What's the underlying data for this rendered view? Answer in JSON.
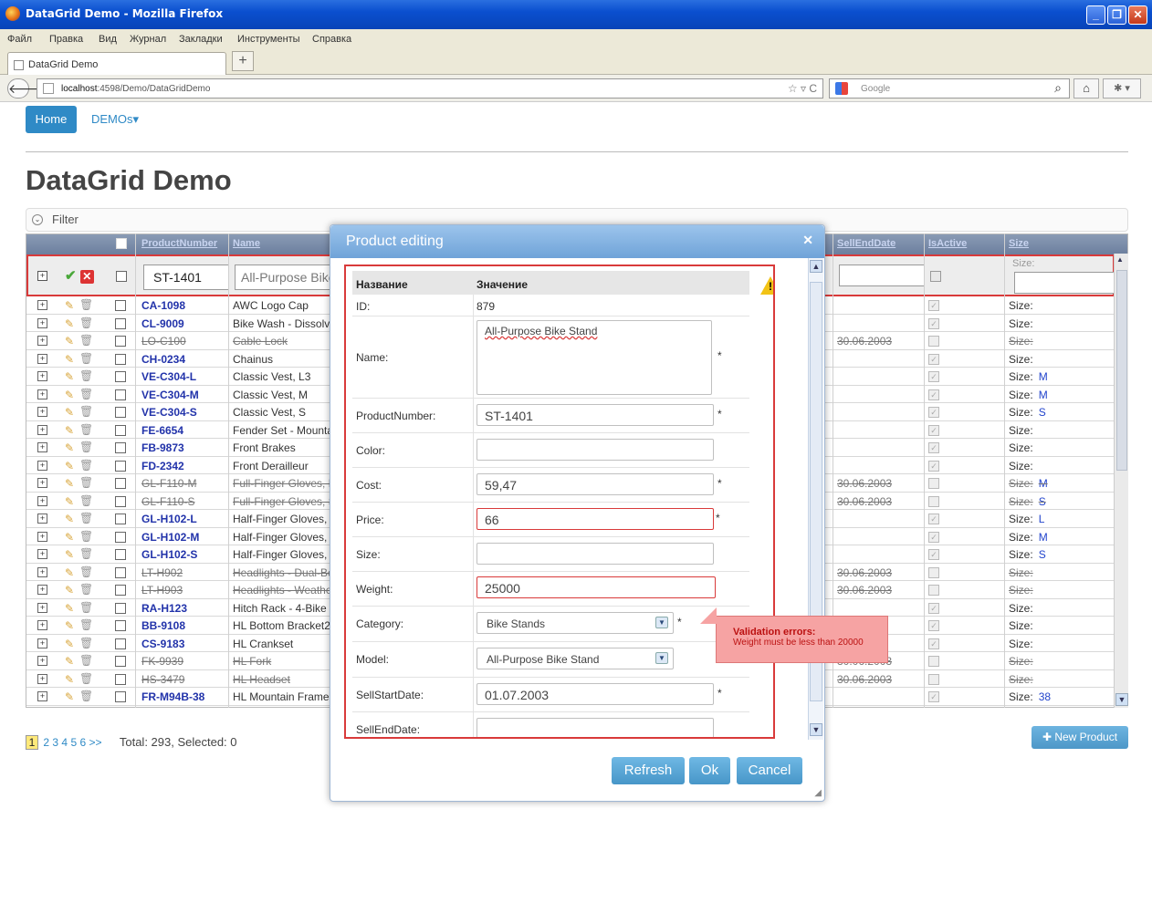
{
  "window": {
    "title": "DataGrid Demo - Mozilla Firefox"
  },
  "menu": [
    "Файл",
    "Правка",
    "Вид",
    "Журнал",
    "Закладки",
    "Инструменты",
    "Справка"
  ],
  "tab": {
    "title": "DataGrid Demo",
    "new_tab": "+"
  },
  "nav": {
    "url_host": "localhost",
    "url_path": ":4598/Demo/DataGridDemo",
    "search_placeholder": "Google"
  },
  "page": {
    "home_label": "Home",
    "demos_label": "DEMOs▾",
    "heading": "DataGrid Demo",
    "filter_label": "Filter"
  },
  "grid": {
    "headers": [
      "ProductNumber",
      "Name",
      "SellEndDate",
      "IsActive",
      "Size"
    ],
    "edit_row": {
      "product_number": "ST-1401",
      "name": "All-Purpose Bike Stand",
      "size_label": "Size:"
    },
    "rows": [
      {
        "pn": "CA-1098",
        "name": "AWC Logo Cap",
        "end": "",
        "deleted": false,
        "size": ""
      },
      {
        "pn": "CL-9009",
        "name": "Bike Wash - Dissolver",
        "end": "",
        "deleted": false,
        "size": ""
      },
      {
        "pn": "LO-C100",
        "name": "Cable Lock",
        "end": "30.06.2003",
        "deleted": true,
        "size": ""
      },
      {
        "pn": "CH-0234",
        "name": "Chainus",
        "end": "",
        "deleted": false,
        "size": ""
      },
      {
        "pn": "VE-C304-L",
        "name": "Classic Vest, L3",
        "end": "",
        "deleted": false,
        "size": "M"
      },
      {
        "pn": "VE-C304-M",
        "name": "Classic Vest, M",
        "end": "",
        "deleted": false,
        "size": "M"
      },
      {
        "pn": "VE-C304-S",
        "name": "Classic Vest, S",
        "end": "",
        "deleted": false,
        "size": "S"
      },
      {
        "pn": "FE-6654",
        "name": "Fender Set - Mountain",
        "end": "",
        "deleted": false,
        "size": ""
      },
      {
        "pn": "FB-9873",
        "name": "Front Brakes",
        "end": "",
        "deleted": false,
        "size": ""
      },
      {
        "pn": "FD-2342",
        "name": "Front Derailleur",
        "end": "",
        "deleted": false,
        "size": ""
      },
      {
        "pn": "GL-F110-M",
        "name": "Full-Finger Gloves, M",
        "end": "30.06.2003",
        "deleted": true,
        "size": "M"
      },
      {
        "pn": "GL-F110-S",
        "name": "Full-Finger Gloves, S",
        "end": "30.06.2003",
        "deleted": true,
        "size": "S"
      },
      {
        "pn": "GL-H102-L",
        "name": "Half-Finger Gloves, L",
        "end": "",
        "deleted": false,
        "size": "L"
      },
      {
        "pn": "GL-H102-M",
        "name": "Half-Finger Gloves, M",
        "end": "",
        "deleted": false,
        "size": "M"
      },
      {
        "pn": "GL-H102-S",
        "name": "Half-Finger Gloves, S",
        "end": "",
        "deleted": false,
        "size": "S"
      },
      {
        "pn": "LT-H902",
        "name": "Headlights - Dual-Beam",
        "end": "30.06.2003",
        "deleted": true,
        "size": ""
      },
      {
        "pn": "LT-H903",
        "name": "Headlights - Weatherproof",
        "end": "30.06.2003",
        "deleted": true,
        "size": ""
      },
      {
        "pn": "RA-H123",
        "name": "Hitch Rack - 4-Bike",
        "end": "",
        "deleted": false,
        "size": ""
      },
      {
        "pn": "BB-9108",
        "name": "HL Bottom Bracket2",
        "end": "",
        "deleted": false,
        "size": ""
      },
      {
        "pn": "CS-9183",
        "name": "HL Crankset",
        "end": "",
        "deleted": false,
        "size": ""
      },
      {
        "pn": "FK-9939",
        "name": "HL Fork",
        "end": "30.06.2003",
        "deleted": true,
        "size": ""
      },
      {
        "pn": "HS-3479",
        "name": "HL Headset",
        "end": "30.06.2003",
        "deleted": true,
        "size": ""
      },
      {
        "pn": "FR-M94B-38",
        "name": "HL Mountain Frame",
        "end": "",
        "deleted": false,
        "size": "38"
      }
    ],
    "size_label": "Size:"
  },
  "pager": {
    "current": "1",
    "pages": [
      "2",
      "3",
      "4",
      "5",
      "6",
      ">>"
    ],
    "total_text": "Total: 293,  Selected: 0"
  },
  "new_product_label": "New Product",
  "dialog": {
    "title": "Product editing",
    "col_name": "Название",
    "col_value": "Значение",
    "fields": {
      "id_label": "ID:",
      "id_value": "879",
      "name_label": "Name:",
      "name_value": "All-Purpose Bike Stand",
      "pn_label": "ProductNumber:",
      "pn_value": "ST-1401",
      "color_label": "Color:",
      "color_value": "",
      "cost_label": "Cost:",
      "cost_value": "59,47",
      "price_label": "Price:",
      "price_value": "66",
      "size_label": "Size:",
      "size_value": "",
      "weight_label": "Weight:",
      "weight_value": "25000",
      "category_label": "Category:",
      "category_value": "Bike Stands",
      "model_label": "Model:",
      "model_value": "All-Purpose Bike Stand",
      "sellstart_label": "SellStartDate:",
      "sellstart_value": "01.07.2003",
      "sellend_label": "SellEndDate:"
    },
    "required_mark": "*",
    "validation_title": "Validation errors:",
    "validation_msg": "Weight must be less than 20000",
    "buttons": {
      "refresh": "Refresh",
      "ok": "Ok",
      "cancel": "Cancel"
    }
  },
  "colors": {
    "accent": "#2f8ac6",
    "error": "#d93a3a",
    "link": "#2233aa"
  }
}
